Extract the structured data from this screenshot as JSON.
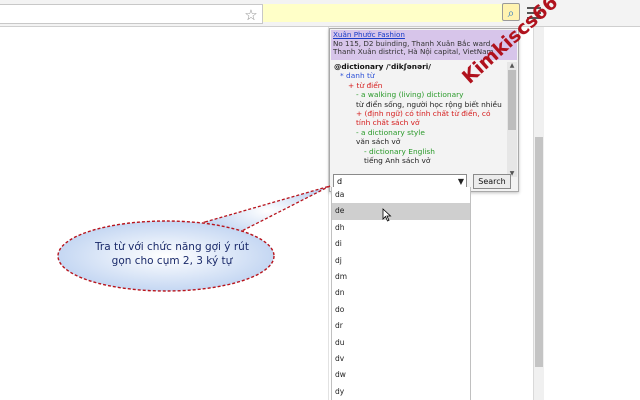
{
  "popup": {
    "header": {
      "link": "Xuân Phước Fashion",
      "address": "No 115, D2 buinding, Thanh Xuân Bắc ward, Thanh Xuân district, Hà Nội capital, VietNam"
    },
    "entry_lines": [
      {
        "text": "@dictionary /'dikʃənəri/",
        "style": "headword",
        "indent": 0
      },
      {
        "text": "* danh từ",
        "style": "pos",
        "indent": 6
      },
      {
        "text": "+ từ điển",
        "style": "red",
        "indent": 14
      },
      {
        "text": "- a walking (living) dictionary",
        "style": "green",
        "indent": 22
      },
      {
        "text": "từ điển sống, người học rộng biết nhiều",
        "style": "black",
        "indent": 22
      },
      {
        "text": "+ (định ngữ) có tính chất từ điển, có",
        "style": "red",
        "indent": 22
      },
      {
        "text": "tính chất sách vở",
        "style": "red",
        "indent": 22
      },
      {
        "text": "- a dictionary style",
        "style": "green",
        "indent": 22
      },
      {
        "text": "văn sách vở",
        "style": "black",
        "indent": 22
      },
      {
        "text": "- dictionary English",
        "style": "green",
        "indent": 30
      },
      {
        "text": "tiếng Anh sách vở",
        "style": "black",
        "indent": 30
      }
    ],
    "search": {
      "value": "d",
      "button_label": "Search",
      "dropdown_arrow": "▼"
    }
  },
  "suggestions": [
    "da",
    "de",
    "dh",
    "di",
    "dj",
    "dm",
    "dn",
    "do",
    "dr",
    "du",
    "dv",
    "dw",
    "dy"
  ],
  "active_suggestion_index": 1,
  "callout": {
    "line1": "Tra từ với chức năng gợi ý rút",
    "line2": "gọn cho cụm 2, 3 ký tự"
  },
  "watermark": "Kimkiscs66",
  "toolbar": {
    "star_glyph": "☆",
    "ext_glyph": "⌕"
  },
  "colors": {
    "header_bg": "#d7c5ea",
    "callout_fill": "#d4e3f7",
    "callout_border": "#b8141c",
    "watermark": "#b0121d"
  }
}
